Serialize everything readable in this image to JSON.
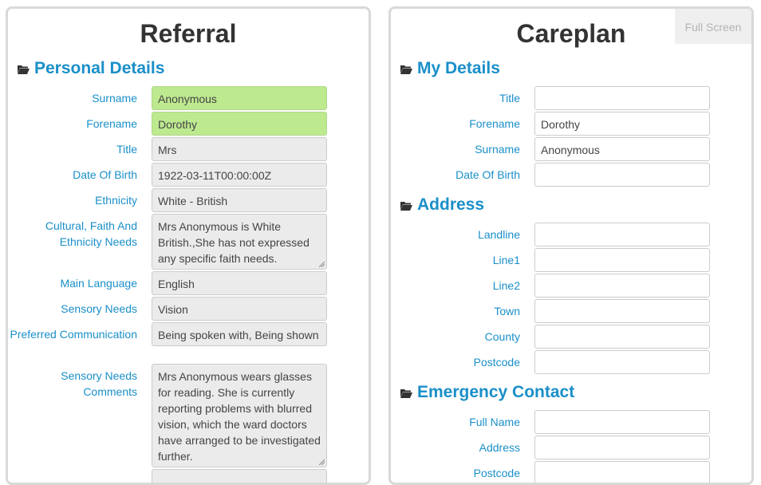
{
  "referral": {
    "title": "Referral",
    "sections": {
      "personal": "Personal Details"
    },
    "fields": {
      "surname": {
        "label": "Surname",
        "value": "Anonymous"
      },
      "forename": {
        "label": "Forename",
        "value": "Dorothy"
      },
      "title": {
        "label": "Title",
        "value": "Mrs"
      },
      "dob": {
        "label": "Date Of Birth",
        "value": "1922-03-11T00:00:00Z"
      },
      "ethnicity": {
        "label": "Ethnicity",
        "value": "White - British"
      },
      "cultural": {
        "label": "Cultural, Faith And Ethnicity Needs",
        "value": "Mrs Anonymous is White British.,She has not expressed any specific faith needs."
      },
      "language": {
        "label": "Main Language",
        "value": "English"
      },
      "sensory": {
        "label": "Sensory Needs",
        "value": "Vision"
      },
      "communication": {
        "label": "Preferred Communication",
        "value": "Being spoken with, Being shown"
      },
      "sensory_comments": {
        "label": "Sensory Needs Comments",
        "value": "Mrs Anonymous wears glasses for reading. She is currently reporting problems with blurred vision, which the ward doctors have arranged to be investigated further."
      }
    }
  },
  "careplan": {
    "title": "Careplan",
    "fullscreen_label": "Full Screen",
    "sections": {
      "my_details": "My Details",
      "address": "Address",
      "emergency": "Emergency Contact"
    },
    "fields": {
      "title": {
        "label": "Title",
        "value": ""
      },
      "forename": {
        "label": "Forename",
        "value": "Dorothy"
      },
      "surname": {
        "label": "Surname",
        "value": "Anonymous"
      },
      "dob": {
        "label": "Date Of Birth",
        "value": ""
      },
      "landline": {
        "label": "Landline",
        "value": ""
      },
      "line1": {
        "label": "Line1",
        "value": ""
      },
      "line2": {
        "label": "Line2",
        "value": ""
      },
      "town": {
        "label": "Town",
        "value": ""
      },
      "county": {
        "label": "County",
        "value": ""
      },
      "postcode": {
        "label": "Postcode",
        "value": ""
      },
      "fullname": {
        "label": "Full Name",
        "value": ""
      },
      "ec_address": {
        "label": "Address",
        "value": ""
      },
      "ec_postcode": {
        "label": "Postcode",
        "value": ""
      }
    }
  },
  "colors": {
    "accent": "#1a8fc9",
    "highlight": "#bde98f",
    "readonly": "#ebebeb"
  },
  "icons": [
    "folder-open-icon",
    "resize-grip-icon"
  ]
}
